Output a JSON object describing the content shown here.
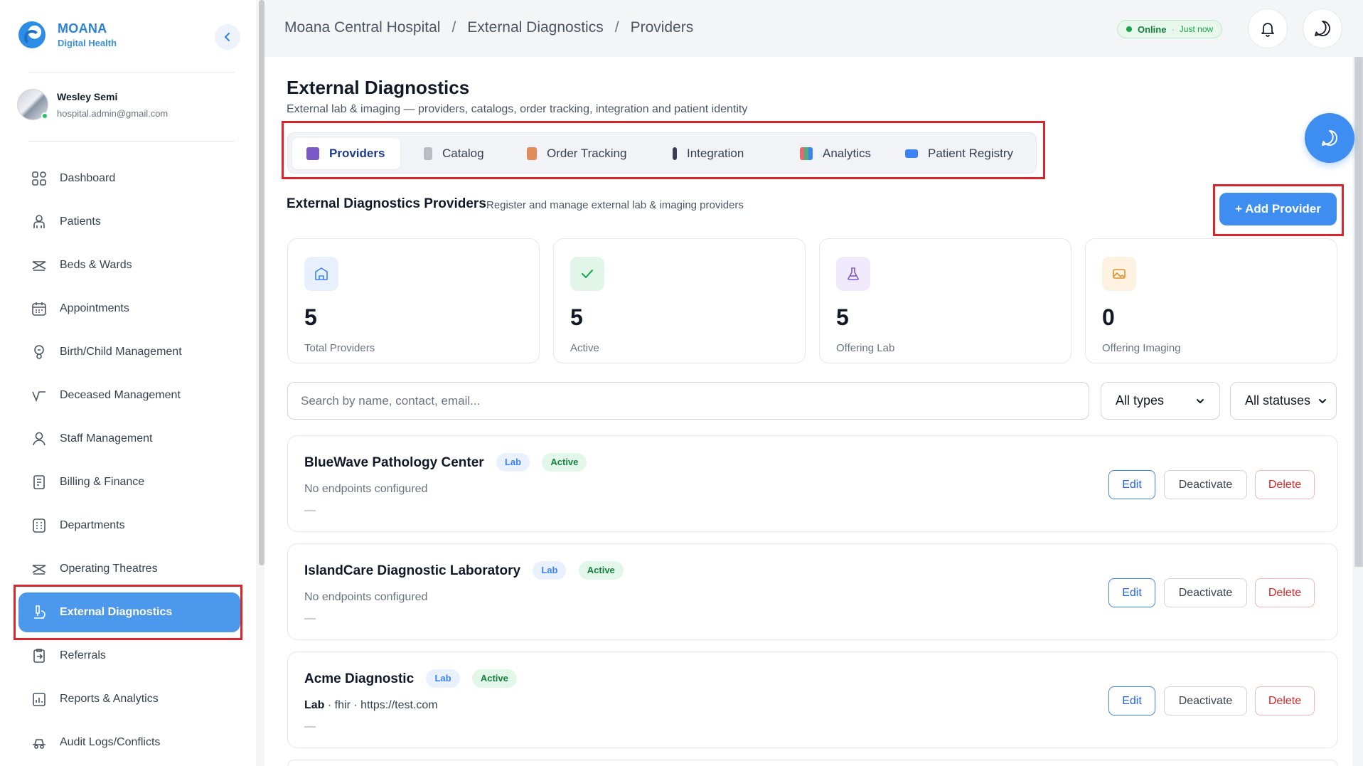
{
  "brand": {
    "title": "MOANA",
    "subtitle": "Digital Health"
  },
  "user": {
    "name": "Wesley Semi",
    "email": "hospital.admin@gmail.com"
  },
  "sidebar": {
    "items": [
      {
        "label": "Dashboard",
        "icon": "dashboard-icon"
      },
      {
        "label": "Patients",
        "icon": "patients-icon"
      },
      {
        "label": "Beds & Wards",
        "icon": "bed-icon"
      },
      {
        "label": "Appointments",
        "icon": "calendar-icon"
      },
      {
        "label": "Birth/Child Management",
        "icon": "baby-icon"
      },
      {
        "label": "Deceased Management",
        "icon": "deceased-icon"
      },
      {
        "label": "Staff Management",
        "icon": "staff-icon"
      },
      {
        "label": "Billing & Finance",
        "icon": "billing-icon"
      },
      {
        "label": "Departments",
        "icon": "departments-icon"
      },
      {
        "label": "Operating Theatres",
        "icon": "theatre-icon"
      },
      {
        "label": "External Diagnostics",
        "icon": "microscope-icon",
        "active": true
      },
      {
        "label": "Referrals",
        "icon": "referral-icon"
      },
      {
        "label": "Reports & Analytics",
        "icon": "reports-icon"
      },
      {
        "label": "Audit Logs/Conflicts",
        "icon": "audit-icon"
      }
    ]
  },
  "header": {
    "breadcrumb": [
      "Moana Central Hospital",
      "External Diagnostics",
      "Providers"
    ],
    "separator": "/",
    "status": {
      "label": "Online",
      "dot": "·",
      "time": "Just now"
    }
  },
  "page": {
    "title": "External Diagnostics",
    "subtitle": "External lab & imaging — providers, catalogs, order tracking, integration and patient identity",
    "tabs": [
      {
        "label": "Providers",
        "active": true,
        "icon_color": "#7c5ac9"
      },
      {
        "label": "Catalog",
        "icon_color": "#9ca3af"
      },
      {
        "label": "Order Tracking",
        "icon_color": "#e38a5c"
      },
      {
        "label": "Integration",
        "icon_color": "#374151"
      },
      {
        "label": "Analytics",
        "icon_color": "#4caf7a"
      },
      {
        "label": "Patient Registry",
        "icon_color": "#3b82f6"
      }
    ],
    "section": {
      "title": "External Diagnostics Providers",
      "subtitle": "Register and manage external lab & imaging providers",
      "add_label": "+ Add Provider"
    },
    "stats": [
      {
        "value": "5",
        "label": "Total Providers",
        "icon": "building-icon",
        "bg": "#e7f0fc",
        "fg": "#3b82f6"
      },
      {
        "value": "5",
        "label": "Active",
        "icon": "check-icon",
        "bg": "#e2f5e9",
        "fg": "#16a34a"
      },
      {
        "value": "5",
        "label": "Offering Lab",
        "icon": "flask-icon",
        "bg": "#efe9fb",
        "fg": "#7c5ac9"
      },
      {
        "value": "0",
        "label": "Offering Imaging",
        "icon": "image-icon",
        "bg": "#fdf1e1",
        "fg": "#e0922f"
      }
    ],
    "search": {
      "placeholder": "Search by name, contact, email...",
      "value": ""
    },
    "filters": {
      "type": "All types",
      "status": "All statuses"
    },
    "providers": [
      {
        "name": "BlueWave Pathology Center",
        "type": "Lab",
        "status": "Active",
        "detail": "No endpoints configured",
        "extra": "—"
      },
      {
        "name": "IslandCare Diagnostic Laboratory",
        "type": "Lab",
        "status": "Active",
        "detail": "No endpoints configured",
        "extra": "—"
      },
      {
        "name": "Acme Diagnostic",
        "type": "Lab",
        "status": "Active",
        "detail_bold": "Lab",
        "detail_rest": " · fhir · https://test.com",
        "extra": "—"
      }
    ],
    "actions": {
      "edit": "Edit",
      "deactivate": "Deactivate",
      "delete": "Delete"
    }
  }
}
